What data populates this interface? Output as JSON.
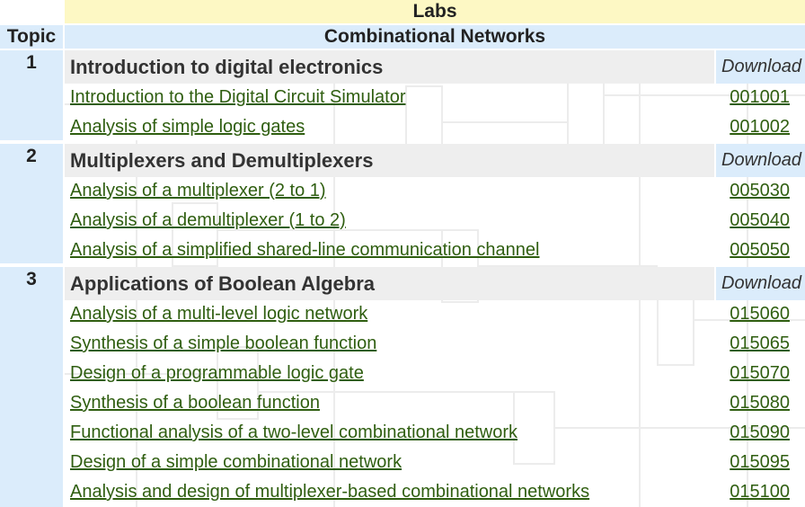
{
  "header": {
    "labs_title": "Labs",
    "topic_label": "Topic",
    "category_title": "Combinational Networks"
  },
  "sections": [
    {
      "number": "1",
      "title": "Introduction to digital electronics",
      "download_label": "Download",
      "labs": [
        {
          "title": "Introduction to the Digital Circuit Simulator",
          "code": "001001"
        },
        {
          "title": "Analysis of simple logic gates",
          "code": "001002"
        }
      ]
    },
    {
      "number": "2",
      "title": "Multiplexers and Demultiplexers",
      "download_label": "Download",
      "labs": [
        {
          "title": "Analysis of a multiplexer (2 to 1)",
          "code": "005030"
        },
        {
          "title": "Analysis of a demultiplexer (1 to 2)",
          "code": "005040"
        },
        {
          "title": "Analysis of a simplified shared-line communication channel",
          "code": "005050"
        }
      ]
    },
    {
      "number": "3",
      "title": "Applications of Boolean Algebra",
      "download_label": "Download",
      "labs": [
        {
          "title": "Analysis of a multi-level logic network",
          "code": "015060"
        },
        {
          "title": "Synthesis of a simple boolean function",
          "code": "015065"
        },
        {
          "title": "Design of a programmable logic gate",
          "code": "015070"
        },
        {
          "title": "Synthesis of a boolean function",
          "code": "015080"
        },
        {
          "title": "Functional analysis of a two-level combinational network",
          "code": "015090"
        },
        {
          "title": "Design of a simple combinational network",
          "code": "015095"
        },
        {
          "title": "Analysis and design of multiplexer-based combinational networks",
          "code": "015100"
        }
      ]
    }
  ],
  "colors": {
    "link": "#2f5e10",
    "header_yellow": "#fdf8c4",
    "header_blue": "#dbecfb",
    "section_gray": "#eeeeee"
  }
}
